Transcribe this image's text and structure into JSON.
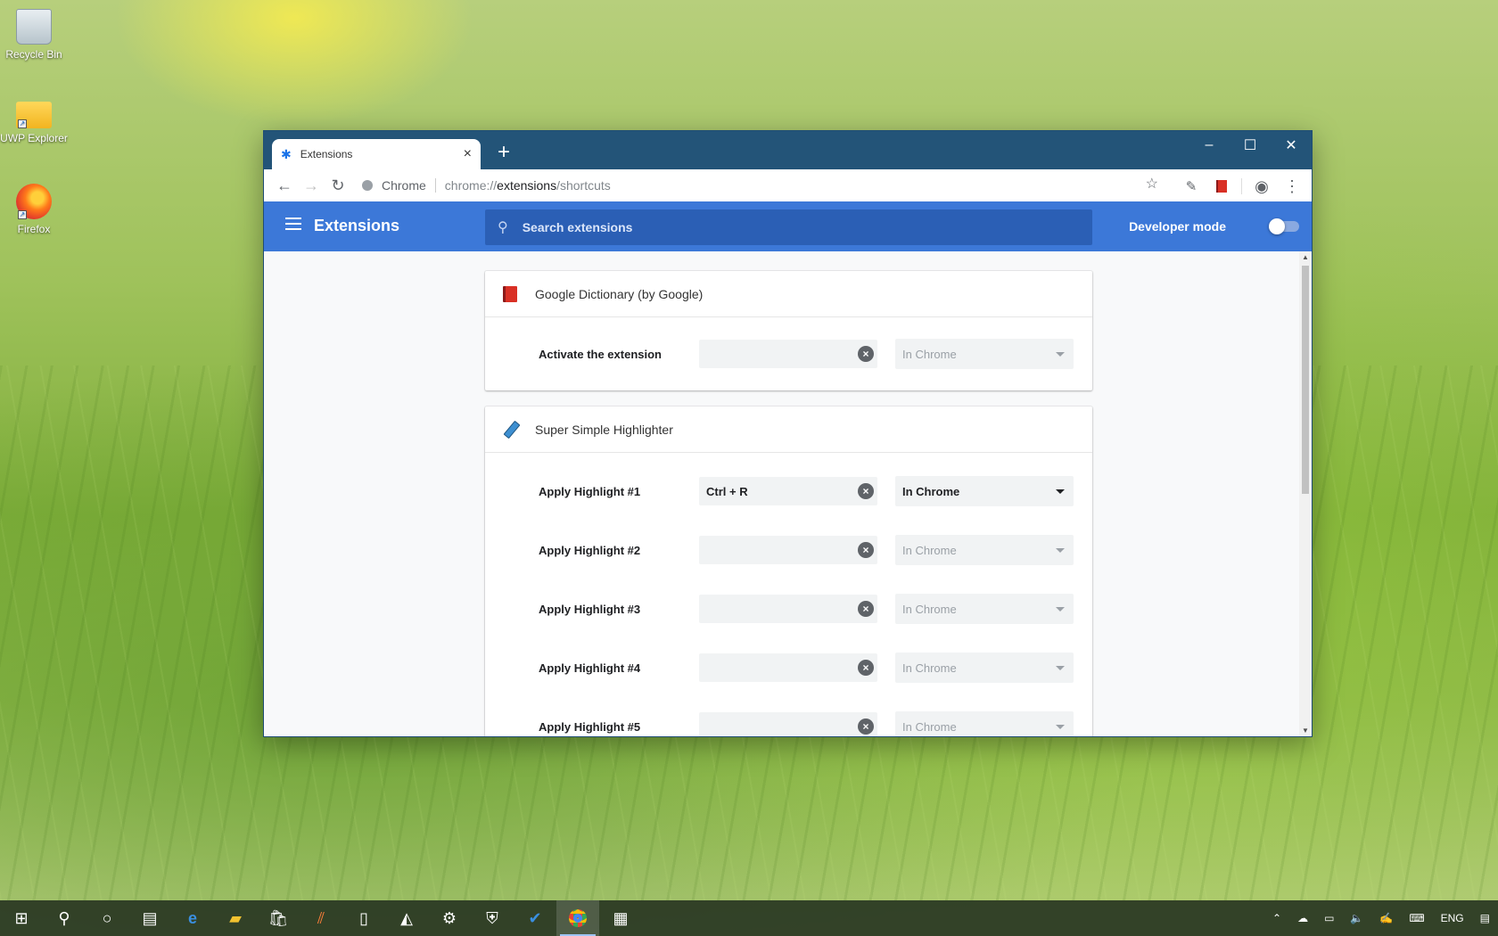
{
  "desktop": {
    "icons": [
      {
        "label": "Recycle Bin",
        "icon": "recycle-bin-icon"
      },
      {
        "label": "UWP Explorer",
        "icon": "folder-icon"
      },
      {
        "label": "Firefox",
        "icon": "firefox-icon"
      }
    ]
  },
  "browser": {
    "tab_title": "Extensions",
    "tab_icon": "puzzle-icon",
    "chip_label": "Chrome",
    "url_scheme": "chrome://",
    "url_host": "extensions",
    "url_path": "/shortcuts"
  },
  "extensions_page": {
    "title": "Extensions",
    "search_placeholder": "Search extensions",
    "developer_mode_label": "Developer mode",
    "developer_mode_on": false,
    "cards": [
      {
        "name": "Google Dictionary (by Google)",
        "icon": "dictionary-icon",
        "shortcuts": [
          {
            "label": "Activate the extension",
            "keys": "",
            "scope": "In Chrome",
            "active": false
          }
        ]
      },
      {
        "name": "Super Simple Highlighter",
        "icon": "highlighter-icon",
        "shortcuts": [
          {
            "label": "Apply Highlight #1",
            "keys": "Ctrl + R",
            "scope": "In Chrome",
            "active": true
          },
          {
            "label": "Apply Highlight #2",
            "keys": "",
            "scope": "In Chrome",
            "active": false
          },
          {
            "label": "Apply Highlight #3",
            "keys": "",
            "scope": "In Chrome",
            "active": false
          },
          {
            "label": "Apply Highlight #4",
            "keys": "",
            "scope": "In Chrome",
            "active": false
          },
          {
            "label": "Apply Highlight #5",
            "keys": "",
            "scope": "In Chrome",
            "active": false
          }
        ]
      }
    ]
  },
  "taskbar": {
    "tray_language": "ENG"
  },
  "colors": {
    "header_blue": "#3c78d8",
    "titlebar": "#235478"
  }
}
